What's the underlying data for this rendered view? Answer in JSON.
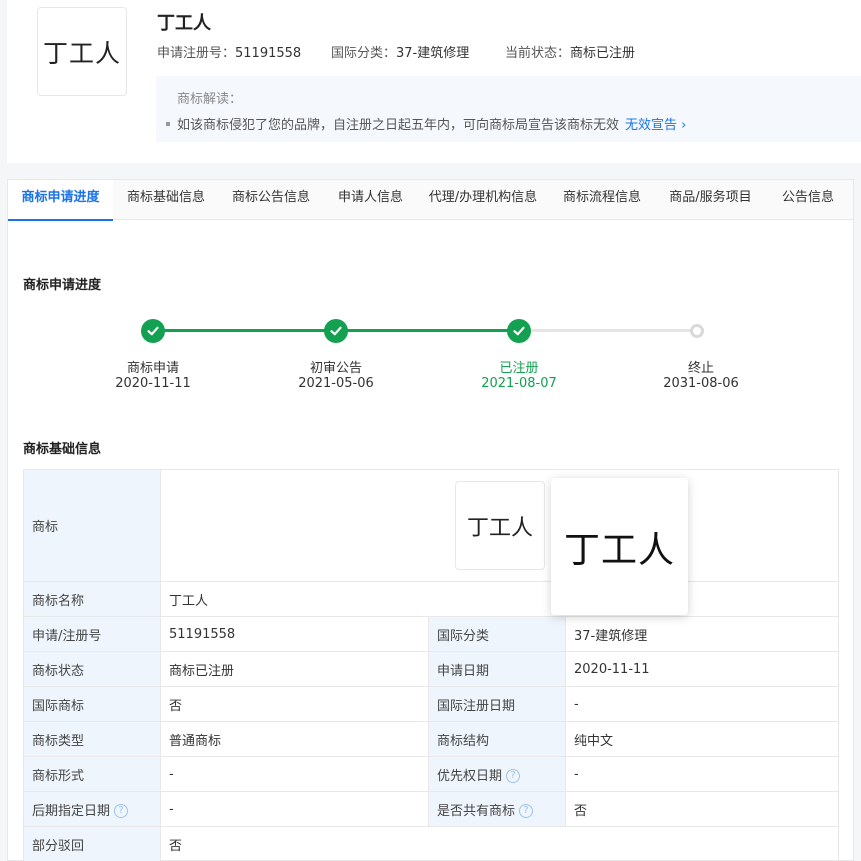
{
  "header": {
    "logo_text": "丁工人",
    "title": "丁工人",
    "reg_no_label": "申请注册号：",
    "reg_no": "51191558",
    "class_label": "国际分类：",
    "class_value": "37-建筑修理",
    "status_label": "当前状态：",
    "status_value": "商标已注册"
  },
  "interpretation": {
    "title": "商标解读：",
    "text": "如该商标侵犯了您的品牌，自注册之日起五年内，可向商标局宣告该商标无效",
    "link": "无效宣告"
  },
  "tabs": [
    {
      "label": "商标申请进度",
      "active": true
    },
    {
      "label": "商标基础信息"
    },
    {
      "label": "商标公告信息"
    },
    {
      "label": "申请人信息"
    },
    {
      "label": "代理/办理机构信息"
    },
    {
      "label": "商标流程信息"
    },
    {
      "label": "商品/服务项目"
    },
    {
      "label": "公告信息"
    }
  ],
  "progress": {
    "title": "商标申请进度",
    "steps": [
      {
        "label": "商标申请",
        "date": "2020-11-11",
        "state": "done"
      },
      {
        "label": "初审公告",
        "date": "2021-05-06",
        "state": "done"
      },
      {
        "label": "已注册",
        "date": "2021-08-07",
        "state": "current"
      },
      {
        "label": "终止",
        "date": "2031-08-06",
        "state": "pending"
      }
    ]
  },
  "basic": {
    "title": "商标基础信息",
    "trademark_label": "商标",
    "trademark_image_text": "丁工人",
    "rows": {
      "name_label": "商标名称",
      "name_value": "丁工人",
      "reg_label": "申请/注册号",
      "reg_value": "51191558",
      "intl_class_label": "国际分类",
      "intl_class_value": "37-建筑修理",
      "status_label": "商标状态",
      "status_value": "商标已注册",
      "apply_date_label": "申请日期",
      "apply_date_value": "2020-11-11",
      "intl_tm_label": "国际商标",
      "intl_tm_value": "否",
      "intl_reg_date_label": "国际注册日期",
      "intl_reg_date_value": "-",
      "type_label": "商标类型",
      "type_value": "普通商标",
      "structure_label": "商标结构",
      "structure_value": "纯中文",
      "form_label": "商标形式",
      "form_value": "-",
      "priority_label": "优先权日期",
      "priority_value": "-",
      "later_label": "后期指定日期",
      "later_value": "-",
      "shared_label": "是否共有商标",
      "shared_value": "否",
      "partial_label": "部分驳回",
      "partial_value": "否"
    }
  },
  "zoom_popup_text": "丁工人",
  "colors": {
    "accent": "#1a73e8",
    "success": "#13a050",
    "pending": "#d9d9d9",
    "key_bg": "#eef5fd"
  }
}
